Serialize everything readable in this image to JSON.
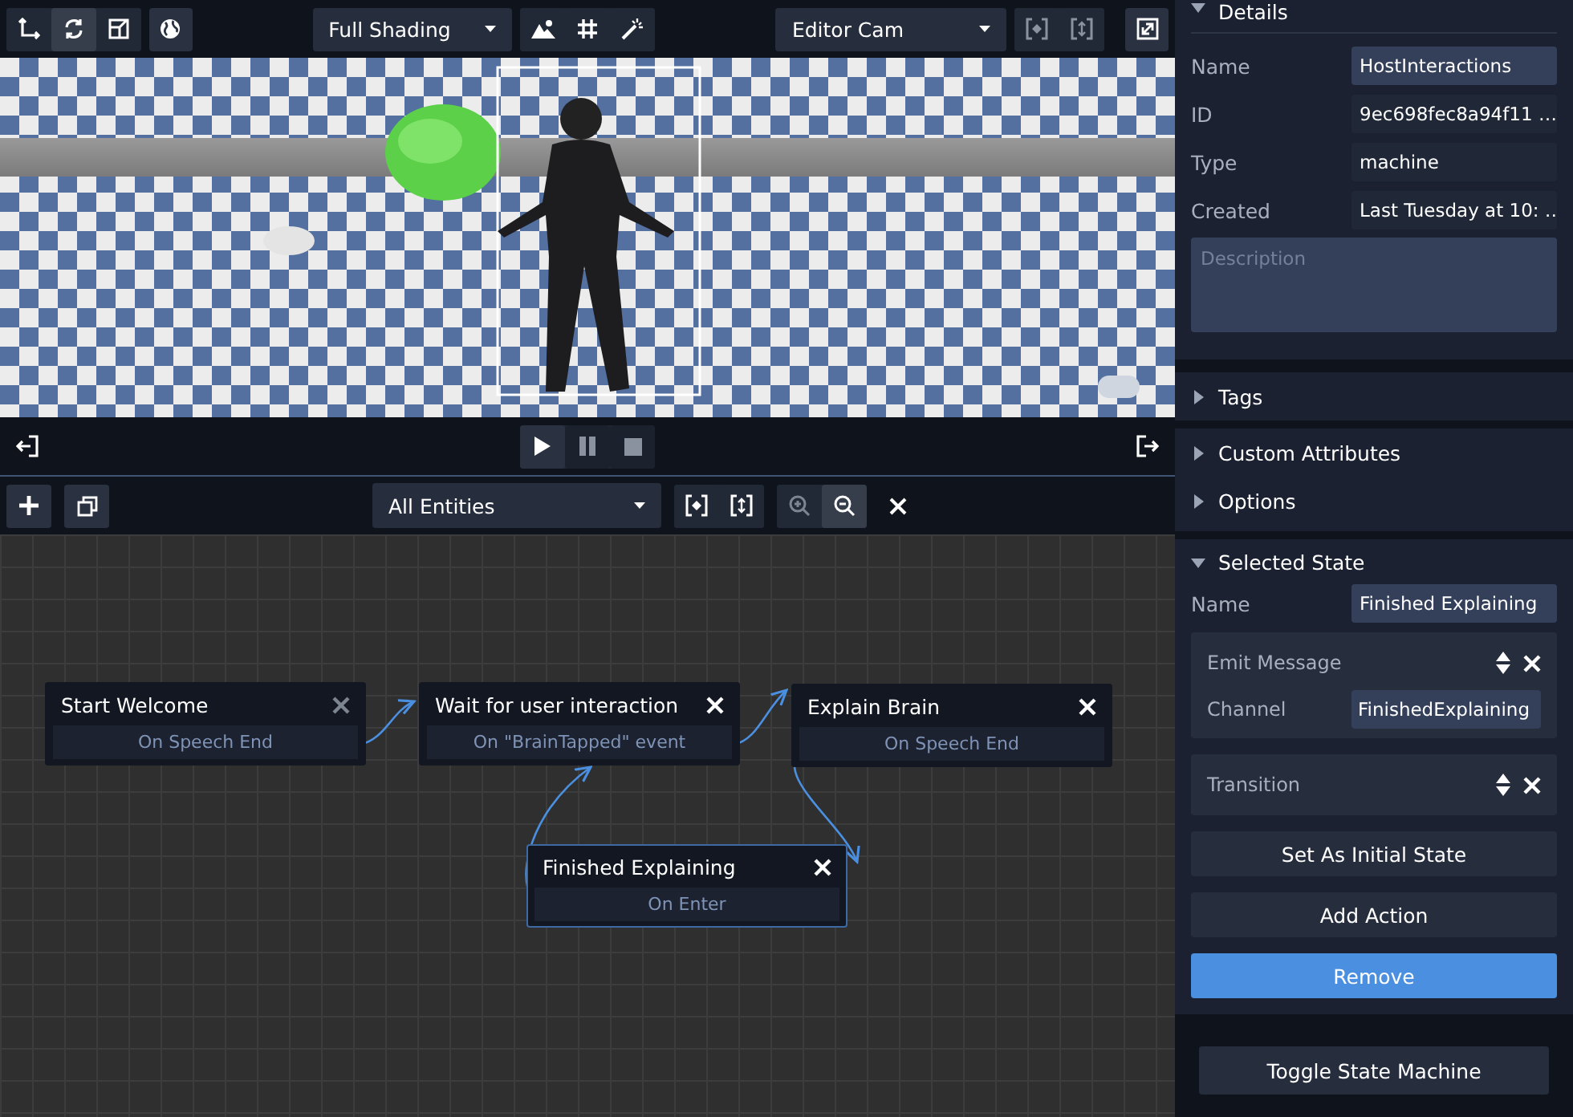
{
  "viewport_toolbar": {
    "transform_tools": [
      {
        "kind": "move",
        "selected": false
      },
      {
        "kind": "rotate",
        "selected": true
      },
      {
        "kind": "scale",
        "selected": false
      }
    ],
    "shading": "Full Shading",
    "camera": "Editor Cam"
  },
  "playback": [
    {
      "kind": "play",
      "selected": true
    },
    {
      "kind": "pause",
      "selected": false
    },
    {
      "kind": "stop",
      "selected": false
    }
  ],
  "graph_toolbar": {
    "filter": "All Entities",
    "zoom": [
      {
        "kind": "zoom-in",
        "disabled": true
      },
      {
        "kind": "zoom-out",
        "disabled": false
      }
    ]
  },
  "nodes": [
    {
      "title": "Start Welcome",
      "event": "On Speech End",
      "selected": false,
      "delete_disabled": true
    },
    {
      "title": "Wait for user interaction",
      "event": "On \"BrainTapped\" event",
      "selected": false,
      "delete_disabled": false
    },
    {
      "title": "Explain Brain",
      "event": "On Speech End",
      "selected": false,
      "delete_disabled": false
    },
    {
      "title": "Finished Explaining",
      "event": "On Enter",
      "selected": true,
      "delete_disabled": false
    }
  ],
  "details": {
    "title": "Details",
    "expanded": true,
    "fields": [
      {
        "label": "Name",
        "value": "HostInteractions",
        "kind": "input"
      },
      {
        "label": "ID",
        "value": "9ec698fec8a94f11 …",
        "kind": "readonly"
      },
      {
        "label": "Type",
        "value": "machine",
        "kind": "readonly"
      },
      {
        "label": "Created",
        "value": "Last Tuesday at 10: …",
        "kind": "readonly"
      }
    ],
    "description_placeholder": "Description"
  },
  "sections": [
    {
      "title": "Tags",
      "expanded": false
    },
    {
      "title": "Custom Attributes",
      "expanded": false
    },
    {
      "title": "Options",
      "expanded": false
    }
  ],
  "selected_state": {
    "title": "Selected State",
    "expanded": true,
    "name_label": "Name",
    "name": "Finished Explaining",
    "actions": [
      {
        "title": "Emit Message",
        "fields": [
          {
            "label": "Channel",
            "value": "FinishedExplaining"
          }
        ]
      },
      {
        "title": "Transition"
      }
    ],
    "buttons": [
      {
        "label": "Set As Initial State",
        "kind": "secondary"
      },
      {
        "label": "Add Action",
        "kind": "secondary"
      },
      {
        "label": "Remove",
        "kind": "primary"
      }
    ]
  },
  "footer_button": "Toggle State Machine"
}
